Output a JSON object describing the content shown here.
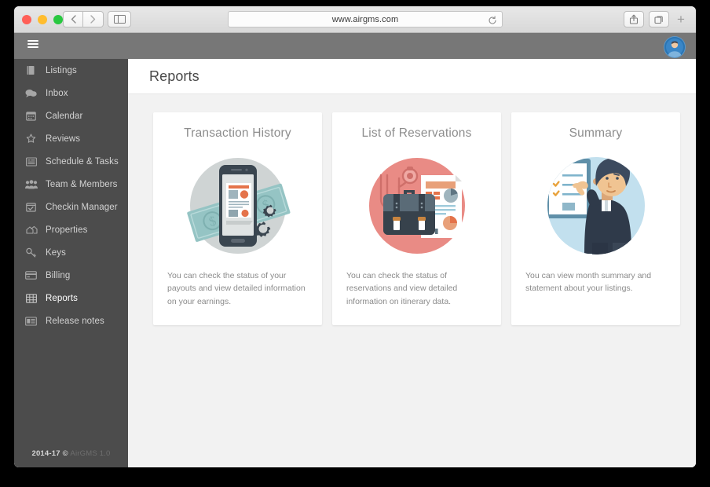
{
  "browser": {
    "url": "www.airgms.com",
    "nav_back_label": "‹",
    "nav_forward_label": "›",
    "sidebar_toggle_name": "show-sidebar",
    "reload_name": "reload-icon",
    "share_name": "share-icon",
    "tabs_name": "tabs-icon",
    "new_tab_label": "+",
    "traffic_lights": [
      "close",
      "minimize",
      "maximize"
    ]
  },
  "topbar": {
    "menu_toggle_name": "hamburger-menu",
    "avatar_name": "user-avatar"
  },
  "sidebar": {
    "items": [
      {
        "label": "Listings",
        "icon": "book-icon",
        "active": false
      },
      {
        "label": "Inbox",
        "icon": "comments-icon",
        "active": false
      },
      {
        "label": "Calendar",
        "icon": "calendar-icon",
        "active": false
      },
      {
        "label": "Reviews",
        "icon": "star-icon",
        "active": false
      },
      {
        "label": "Schedule & Tasks",
        "icon": "list-icon",
        "active": false
      },
      {
        "label": "Team & Members",
        "icon": "users-icon",
        "active": false
      },
      {
        "label": "Checkin Manager",
        "icon": "calendar-check-icon",
        "active": false
      },
      {
        "label": "Properties",
        "icon": "houses-icon",
        "active": false
      },
      {
        "label": "Keys",
        "icon": "key-icon",
        "active": false
      },
      {
        "label": "Billing",
        "icon": "credit-card-icon",
        "active": false
      },
      {
        "label": "Reports",
        "icon": "table-icon",
        "active": true
      },
      {
        "label": "Release notes",
        "icon": "news-icon",
        "active": false
      }
    ],
    "footer_copyright": "2014-17 ©",
    "footer_version": "AirGMS 1.0"
  },
  "main": {
    "page_title": "Reports",
    "cards": [
      {
        "title": "Transaction History",
        "description": "You can check the status of your payouts and view detailed information on your earnings.",
        "art": "phone-money-gears",
        "circle_color": "#cfd4d4"
      },
      {
        "title": "List of Reservations",
        "description": "You can check the status of reservations and view detailed information on itinerary data.",
        "art": "briefcase-documents",
        "circle_color": "#e98b85"
      },
      {
        "title": "Summary",
        "description": "You can view month summary and statement about your listings.",
        "art": "man-clipboard",
        "circle_color": "#c2e0ee"
      }
    ]
  },
  "colors": {
    "sidebar_bg": "#4c4c4c",
    "topbar_bg": "#777777",
    "content_bg": "#f2f2f2",
    "card_bg": "#ffffff",
    "avatar_blue": "#2b75b3"
  }
}
